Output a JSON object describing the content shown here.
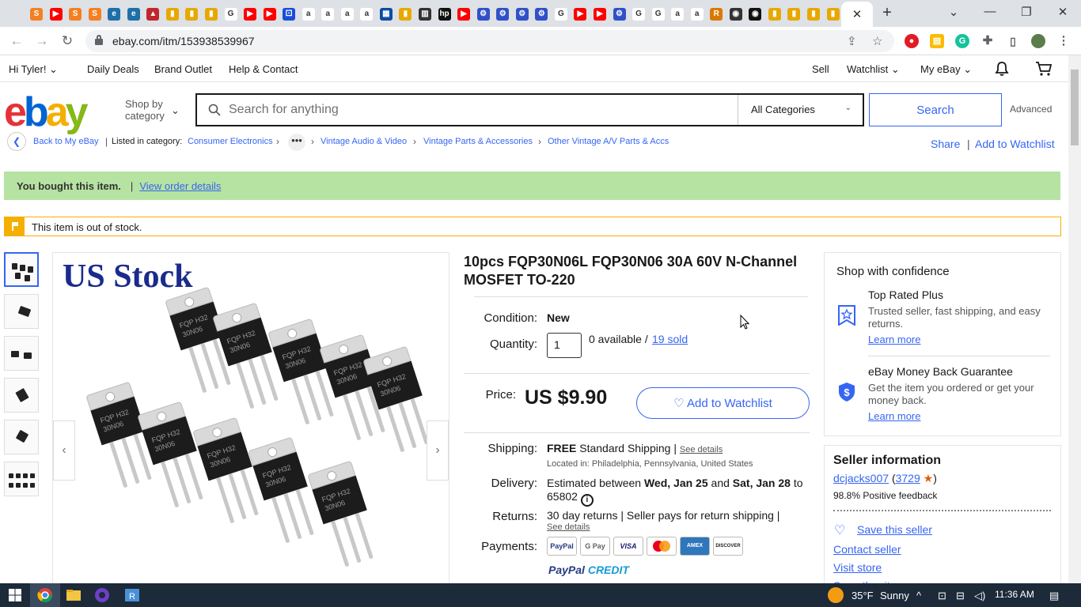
{
  "browser": {
    "url": "ebay.com/itm/153938539967",
    "favicons": [
      {
        "label": "S",
        "color": "#f48024"
      },
      {
        "label": "▶",
        "color": "#ff0000"
      },
      {
        "label": "S",
        "color": "#f48024"
      },
      {
        "label": "S",
        "color": "#f48024"
      },
      {
        "label": "e",
        "color": "#1f6fa8"
      },
      {
        "label": "e",
        "color": "#1f6fa8"
      },
      {
        "label": "▲",
        "color": "#c0262d"
      },
      {
        "label": "▮",
        "color": "#e8a800"
      },
      {
        "label": "▮",
        "color": "#e8a800"
      },
      {
        "label": "▮",
        "color": "#e8a800"
      },
      {
        "label": "G",
        "color": "#ffffff"
      },
      {
        "label": "▶",
        "color": "#ff0000"
      },
      {
        "label": "▶",
        "color": "#ff0000"
      },
      {
        "label": "⚀",
        "color": "#1a4ed8"
      },
      {
        "label": "a",
        "color": "#ffffff"
      },
      {
        "label": "a",
        "color": "#ffffff"
      },
      {
        "label": "a",
        "color": "#ffffff"
      },
      {
        "label": "a",
        "color": "#ffffff"
      },
      {
        "label": "▦",
        "color": "#0b4da2"
      },
      {
        "label": "▮",
        "color": "#e8a800"
      },
      {
        "label": "▥",
        "color": "#333333"
      },
      {
        "label": "hp",
        "color": "#111111"
      },
      {
        "label": "▶",
        "color": "#ff0000"
      },
      {
        "label": "⚙",
        "color": "#3050c8"
      },
      {
        "label": "⚙",
        "color": "#3050c8"
      },
      {
        "label": "⚙",
        "color": "#3050c8"
      },
      {
        "label": "⚙",
        "color": "#3050c8"
      },
      {
        "label": "G",
        "color": "#ffffff"
      },
      {
        "label": "▶",
        "color": "#ff0000"
      },
      {
        "label": "▶",
        "color": "#ff0000"
      },
      {
        "label": "⚙",
        "color": "#3050c8"
      },
      {
        "label": "G",
        "color": "#ffffff"
      },
      {
        "label": "G",
        "color": "#ffffff"
      },
      {
        "label": "a",
        "color": "#ffffff"
      },
      {
        "label": "a",
        "color": "#ffffff"
      },
      {
        "label": "R",
        "color": "#d97a00"
      },
      {
        "label": "◉",
        "color": "#333333"
      },
      {
        "label": "◉",
        "color": "#111111"
      },
      {
        "label": "▮",
        "color": "#e8a800"
      },
      {
        "label": "▮",
        "color": "#e8a800"
      },
      {
        "label": "▮",
        "color": "#e8a800"
      },
      {
        "label": "▮",
        "color": "#e8a800"
      },
      {
        "label": "▮",
        "color": "#e8a800"
      }
    ]
  },
  "topnav": {
    "greeting": "Hi Tyler!",
    "daily_deals": "Daily Deals",
    "brand_outlet": "Brand Outlet",
    "help": "Help & Contact",
    "sell": "Sell",
    "watchlist": "Watchlist",
    "my_ebay": "My eBay"
  },
  "header": {
    "logo": {
      "e": "e",
      "b": "b",
      "a": "a",
      "y": "y"
    },
    "shop_by_line1": "Shop by",
    "shop_by_line2": "category",
    "search_placeholder": "Search for anything",
    "category": "All Categories",
    "search_button": "Search",
    "advanced": "Advanced"
  },
  "breadcrumb": {
    "back": "Back to My eBay",
    "listed_in": "Listed in category:",
    "items": [
      "Consumer Electronics",
      "Vintage Audio & Video",
      "Vintage Parts & Accessories",
      "Other Vintage A/V Parts & Accs"
    ],
    "share": "Share",
    "add_to_watchlist": "Add to Watchlist"
  },
  "banners": {
    "bought": "You bought this item.",
    "view_order": "View order details",
    "out_of_stock": "This item is out of stock."
  },
  "image": {
    "overlay_text": "US Stock",
    "part_marking": [
      "FQP",
      "30N06",
      "H32"
    ]
  },
  "item": {
    "title": "10pcs FQP30N06L FQP30N06 30A 60V N-Channel MOSFET TO-220",
    "condition_label": "Condition:",
    "condition": "New",
    "quantity_label": "Quantity:",
    "quantity": "1",
    "available": "0 available /",
    "sold": "19 sold",
    "price_label": "Price:",
    "price": "US $9.90",
    "watchlist_button": "♡ Add to Watchlist",
    "shipping_label": "Shipping:",
    "shipping_free": "FREE",
    "shipping_text": "Standard Shipping |",
    "see_details": "See details",
    "located": "Located in: Philadelphia, Pennsylvania, United States",
    "delivery_label": "Delivery:",
    "delivery_pre": "Estimated between",
    "delivery_from": "Wed, Jan 25",
    "delivery_and": "and",
    "delivery_to": "Sat, Jan 28",
    "delivery_post": "to",
    "delivery_zip": "65802",
    "returns_label": "Returns:",
    "returns_text": "30 day returns | Seller pays for return shipping |",
    "returns_details": "See details",
    "payments_label": "Payments:",
    "payment_methods": [
      "PayPal",
      "G Pay",
      "VISA",
      "MC",
      "AMEX",
      "DISCOVER"
    ],
    "paypal_credit_a": "PayPal",
    "paypal_credit_b": "CREDIT"
  },
  "confidence": {
    "heading": "Shop with confidence",
    "trp_title": "Top Rated Plus",
    "trp_desc": "Trusted seller, fast shipping, and easy returns.",
    "trp_link": "Learn more",
    "mbg_title": "eBay Money Back Guarantee",
    "mbg_desc": "Get the item you ordered or get your money back.",
    "mbg_link": "Learn more"
  },
  "seller": {
    "heading": "Seller information",
    "name": "dcjacks007",
    "score_open": "(",
    "score": "3729",
    "score_close": ")",
    "feedback": "98.8% Positive feedback",
    "save": "Save this seller",
    "contact": "Contact seller",
    "visit": "Visit store",
    "see_other": "See other items"
  },
  "taskbar": {
    "weather_temp": "35°F",
    "weather_cond": "Sunny",
    "time": "11:36 AM"
  },
  "colors": {
    "ebay_blue": "#3665f3",
    "bought_banner": "#b7e3a2",
    "oos_accent": "#f5af02"
  }
}
